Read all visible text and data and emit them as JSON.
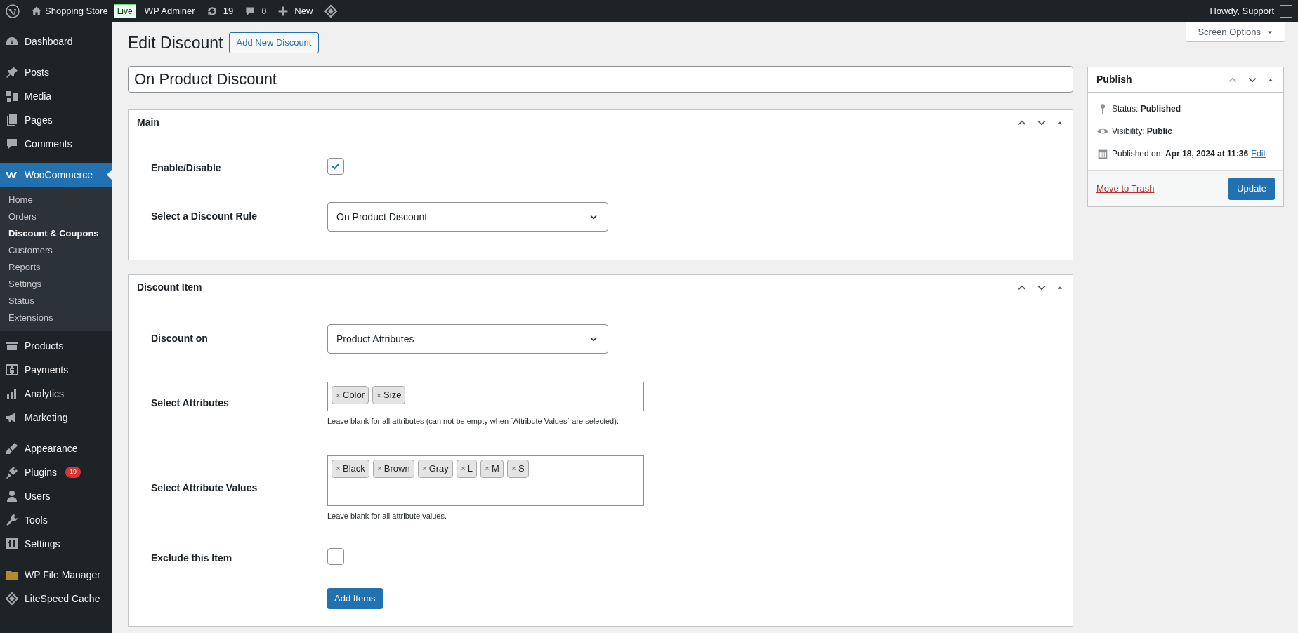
{
  "admin_bar": {
    "site": "Shopping Store",
    "live_badge": "Live",
    "plugin_link": "WP Adminer",
    "updates": "19",
    "comments": "0",
    "new": "New",
    "greeting": "Howdy, Support"
  },
  "sidebar": {
    "items": [
      {
        "label": "Dashboard",
        "selected": false
      },
      {
        "label": "Posts",
        "selected": false
      },
      {
        "label": "Media",
        "selected": false
      },
      {
        "label": "Pages",
        "selected": false
      },
      {
        "label": "Comments",
        "selected": false
      },
      {
        "label": "WooCommerce",
        "selected": true,
        "children": [
          {
            "label": "Home",
            "selected": false
          },
          {
            "label": "Orders",
            "selected": false
          },
          {
            "label": "Discount & Coupons",
            "selected": true
          },
          {
            "label": "Customers",
            "selected": false
          },
          {
            "label": "Reports",
            "selected": false
          },
          {
            "label": "Settings",
            "selected": false
          },
          {
            "label": "Status",
            "selected": false
          },
          {
            "label": "Extensions",
            "selected": false
          }
        ]
      },
      {
        "label": "Products",
        "selected": false
      },
      {
        "label": "Payments",
        "selected": false
      },
      {
        "label": "Analytics",
        "selected": false
      },
      {
        "label": "Marketing",
        "selected": false
      },
      {
        "label": "Appearance",
        "selected": false
      },
      {
        "label": "Plugins",
        "selected": false,
        "badge": "19"
      },
      {
        "label": "Users",
        "selected": false
      },
      {
        "label": "Tools",
        "selected": false
      },
      {
        "label": "Settings",
        "selected": false
      },
      {
        "label": "WP File Manager",
        "selected": false
      },
      {
        "label": "LiteSpeed Cache",
        "selected": false
      }
    ]
  },
  "screen_options": "Screen Options",
  "page_title": "Edit Discount",
  "add_new_button": "Add New Discount",
  "title_value": "On Product Discount",
  "postboxes": [
    {
      "title": "Main",
      "fields": [
        {
          "kind": "checkbox",
          "label": "Enable/Disable",
          "checked": true
        },
        {
          "kind": "select",
          "label": "Select a Discount Rule",
          "value": "On Product Discount"
        }
      ]
    },
    {
      "title": "Discount Item",
      "fields": [
        {
          "kind": "select",
          "label": "Discount on",
          "value": "Product Attributes"
        },
        {
          "kind": "tags",
          "label": "Select Attributes",
          "tags": [
            "Color",
            "Size"
          ],
          "help": "Leave blank for all attributes (can not be empty when `Attribute Values` are selected)."
        },
        {
          "kind": "tags",
          "label": "Select Attribute Values",
          "tags": [
            "Black",
            "Brown",
            "Gray",
            "L",
            "M",
            "S"
          ],
          "help": "Leave blank for all attribute values."
        },
        {
          "kind": "checkbox",
          "label": "Exclude this Item",
          "checked": false
        },
        {
          "kind": "button",
          "label": "Add Items"
        }
      ]
    }
  ],
  "publish": {
    "title": "Publish",
    "status_label": "Status:",
    "status": "Published",
    "visibility_label": "Visibility:",
    "visibility": "Public",
    "published_label": "Published on:",
    "published": "Apr 18, 2024 at 11:36",
    "edit_link": "Edit",
    "trash_link": "Move to Trash",
    "update_button": "Update"
  }
}
